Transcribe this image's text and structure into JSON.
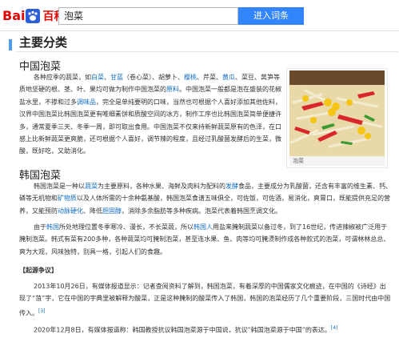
{
  "header": {
    "logo_bai": "Bai",
    "logo_baike": "百科",
    "search_value": "泡菜",
    "enter_button": "进入词条"
  },
  "section": {
    "title": "主要分类"
  },
  "chinese": {
    "title": "中国泡菜",
    "para1_a": "各种应季的蔬菜，如",
    "link_baicai": "白菜",
    "para1_b": "、",
    "link_ganlan": "甘蓝",
    "para1_c": "（卷心菜）、胡萝卜、",
    "link_yangcong": "樱桃",
    "para1_d": "、芹菜、",
    "link_huanggua": "黄瓜",
    "para1_e": "、菜豆、莴笋等质地坚硬的根、茎、叶、果均可做为制作中国泡菜的",
    "link_yuanliao": "原料",
    "para1_f": "。中国泡菜一般都是泡在盛装的花椒盐水里，不掺和过多",
    "link_tiaowei": "调味品",
    "para1_g": "，完全是单纯要明的口味，当然也可根据个人喜好添加其他佐料，汉界中国泡菜比韩国泡菜更有唯细素饼和质酸空间的冰方，制作工序也比韩国泡菜简单便捷许多，通常夏季三天、冬季一周，即可取出食用。中国泡菜不仅来持新鲜蔬菜原有的色泽，在口感上比新鲜蔬菜更爽脆，还可根据个人喜好，调节辣的程度，且经过乳酸菌发酵后的生菜，微酸，既好吃，又助消化。",
    "caption": "泡菜"
  },
  "korean": {
    "title": "韩国泡菜",
    "para1_a": "韩国泡菜是一种以",
    "link_shucai": "蔬菜",
    "para1_b": "为主要原料，各种水果、海鲜及肉料为配料的",
    "link_fajiao": "发酵",
    "para1_c": "食品，主要成分为乳酸菌，还含有丰富的维生素、钙、磷等无机物和",
    "link_kuangwu": "矿物质",
    "para1_d": "以及人体所需的十余种氨基酸，韩国泡菜食谱五味俱全，可佐饭，可佐酒，易消化，爽胃口，既能提供充足的营养，又能预防",
    "link_dongmai": "动脉硬化",
    "para1_e": "、降低",
    "link_danguchun": "胆固醇",
    "para1_f": "，消除多余脂肪等多种疾病。泡菜代表着韩国烹调文化。",
    "para2_a": "由于",
    "link_hanguo": "韩国",
    "para2_b": "所处地理位置冬季寒冷、漫长，不长菜蔬，所以",
    "link_hanguoren": "韩国人",
    "para2_c": "用盐来腌制蔬菜以备过冬，到了16世纪，传进辣椒被广泛用于腌制泡菜。韩式有菜有200多种，各种蔬菜均可腌制泡菜，甚至连水果、鱼、肉等均可腌渍制作成各种款式的泡菜，可谓林林总总、爽为大观，风味独特，别具一格，引起人们的食趣。"
  },
  "dispute": {
    "heading": "【起源争议】",
    "para1": "2013年10月26日，有媒体报道显示：记者查阅资料了解到，韩国泡菜，有着深厚的中国儒家文化痕迹，在中国的《诗经》出现了“菹”字，它在中国的字典里被解释为酸菜，正是这种腌制的酸菜传入了韩国，韩国的泡菜经历了几个重要阶段，三国时代由中国传入。",
    "sup1": "[3]",
    "para2": "2020年12月8日，有媒体报道称：韩国教授抗议韩国泡菜源于中国说，抗议“韩国泡菜源于中国”的表达。",
    "sup2": "[4]"
  },
  "colors": {
    "accent": "#3385ff",
    "logo_red": "#e10602",
    "link": "#136ec2",
    "side_bar": "#4f9cee"
  }
}
